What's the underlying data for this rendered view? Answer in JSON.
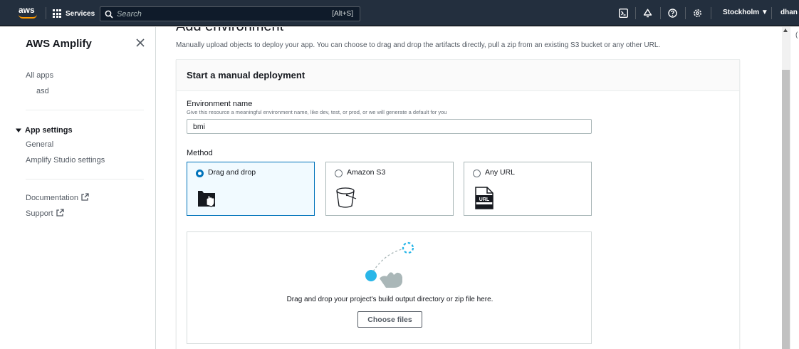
{
  "topnav": {
    "logo_text": "aws",
    "services_label": "Services",
    "search_placeholder": "Search",
    "search_shortcut": "[Alt+S]",
    "region": "Stockholm ▼",
    "user": "dhan ▼",
    "icons": [
      "cloudshell-icon",
      "bell-icon",
      "help-icon",
      "settings-icon"
    ]
  },
  "sidebar": {
    "title": "AWS Amplify",
    "all_apps": "All apps",
    "app_name": "asd",
    "app_settings_heading": "App settings",
    "general": "General",
    "studio_settings": "Amplify Studio settings",
    "documentation": "Documentation",
    "support": "Support"
  },
  "main": {
    "page_title": "Add environment",
    "description": "Manually upload objects to deploy your app. You can choose to drag and drop the artifacts directly, pull a zip from an existing S3 bucket or any other URL.",
    "card_title": "Start a manual deployment",
    "env_label": "Environment name",
    "env_desc": "Give this resource a meaningful environment name, like dev, test, or prod, or we will generate a default for you",
    "env_value": "bmi",
    "method_label": "Method",
    "methods": [
      {
        "label": "Drag and drop",
        "selected": true,
        "icon": "drag-drop-icon"
      },
      {
        "label": "Amazon S3",
        "selected": false,
        "icon": "s3-bucket-icon"
      },
      {
        "label": "Any URL",
        "selected": false,
        "icon": "url-file-icon"
      }
    ],
    "dropzone_text": "Drag and drop your project's build output directory or zip file here.",
    "choose_files": "Choose files"
  },
  "colors": {
    "nav_bg": "#232f3e",
    "accent": "#0073bb",
    "orange": "#ff9900",
    "illustration_blue": "#29b6e8"
  },
  "right_strip_text": "("
}
